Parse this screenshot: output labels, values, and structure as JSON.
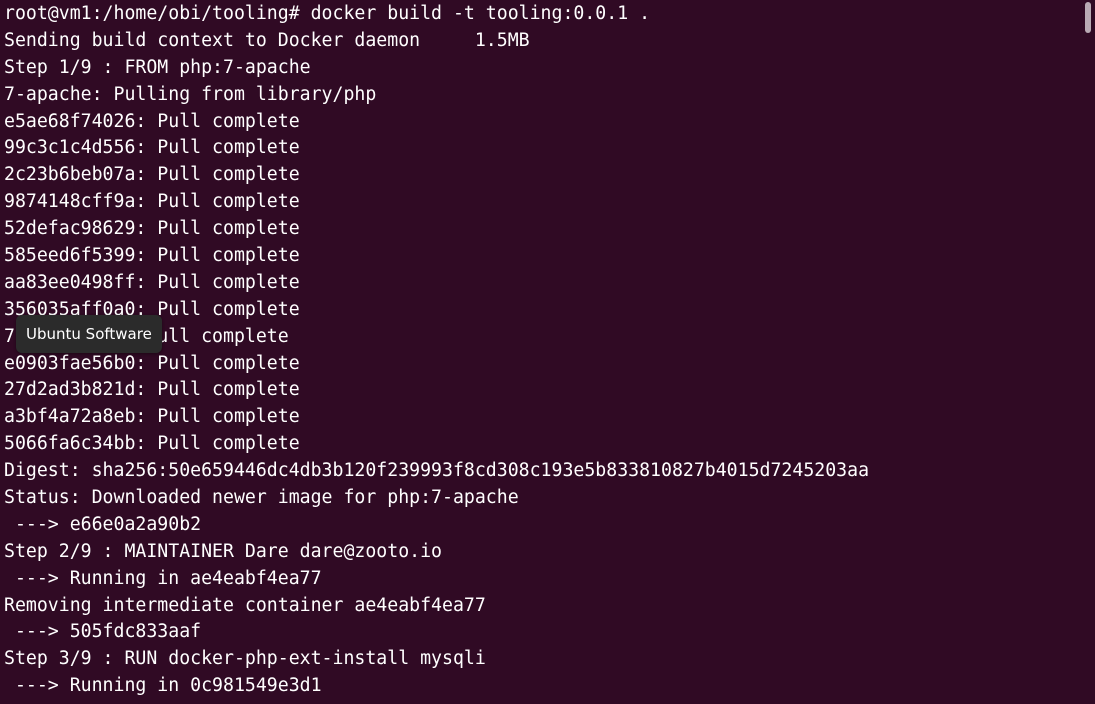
{
  "terminal": {
    "lines": [
      "root@vm1:/home/obi/tooling# docker build -t tooling:0.0.1 .",
      "Sending build context to Docker daemon     1.5MB",
      "Step 1/9 : FROM php:7-apache",
      "7-apache: Pulling from library/php",
      "e5ae68f74026: Pull complete",
      "99c3c1c4d556: Pull complete",
      "2c23b6beb07a: Pull complete",
      "9874148cff9a: Pull complete",
      "52defac98629: Pull complete",
      "585eed6f5399: Pull complete",
      "aa83ee0498ff: Pull complete",
      "356035aff0a0: Pull complete",
      "7          : Pull complete",
      "e0903fae56b0: Pull complete",
      "27d2ad3b821d: Pull complete",
      "a3bf4a72a8eb: Pull complete",
      "5066fa6c34bb: Pull complete",
      "Digest: sha256:50e659446dc4db3b120f239993f8cd308c193e5b833810827b4015d7245203aa",
      "Status: Downloaded newer image for php:7-apache",
      " ---> e66e0a2a90b2",
      "Step 2/9 : MAINTAINER Dare dare@zooto.io",
      " ---> Running in ae4eabf4ea77",
      "Removing intermediate container ae4eabf4ea77",
      " ---> 505fdc833aaf",
      "Step 3/9 : RUN docker-php-ext-install mysqli",
      " ---> Running in 0c981549e3d1"
    ]
  },
  "tooltip": {
    "label": "Ubuntu Software"
  },
  "colors": {
    "background": "#300a24",
    "text": "#ffffff",
    "tooltip_background": "#2b2b2b",
    "scrollbar_thumb": "#b9aab4"
  }
}
